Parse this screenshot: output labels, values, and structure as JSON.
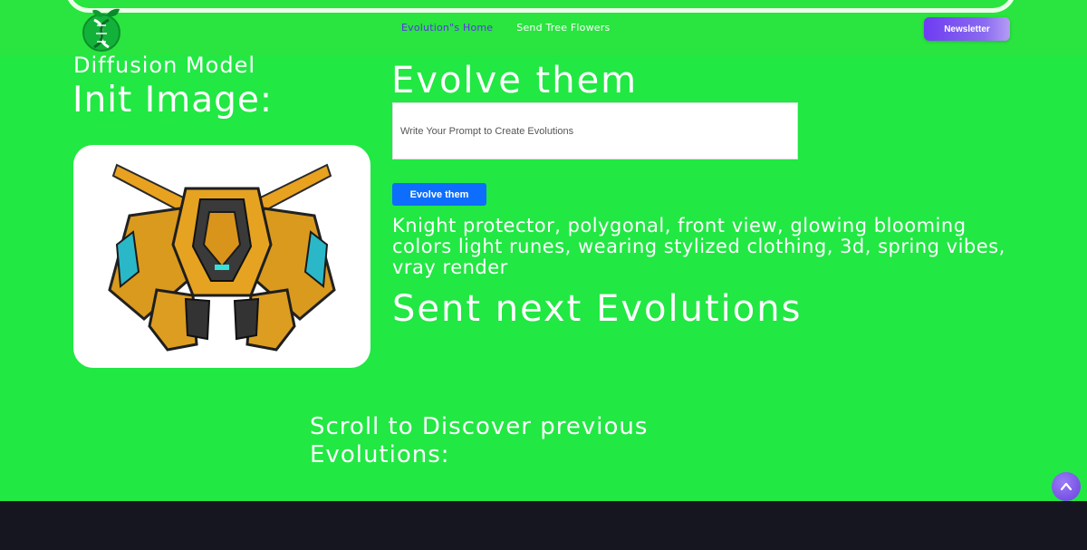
{
  "header": {
    "logo_icon": "dna-leaf-logo-icon",
    "nav": [
      {
        "label": "Evolution\"s Home",
        "active": true
      },
      {
        "label": "Send Tree Flowers",
        "active": false
      }
    ],
    "newsletter_label": "Newsletter"
  },
  "left": {
    "subtitle": "Diffusion Model",
    "title": "Init Image:",
    "image_alt": "yellow robot mech"
  },
  "main": {
    "heading": "Evolve them",
    "prompt_placeholder": "Write Your Prompt to Create Evolutions",
    "prompt_value": "",
    "evolve_button": "Evolve them",
    "prompt_text": "Knight protector, polygonal, front view, glowing blooming colors light runes, wearing stylized clothing, 3d, spring vibes, vray render",
    "sent_heading": "Sent next Evolutions",
    "scroll_heading": "Scroll to Discover previous Evolutions:"
  },
  "back_to_top_icon": "chevron-up-icon",
  "colors": {
    "background": "#21e843",
    "accent": "#6e3cf2",
    "button_blue": "#0d6efd",
    "footer": "#15161f"
  }
}
